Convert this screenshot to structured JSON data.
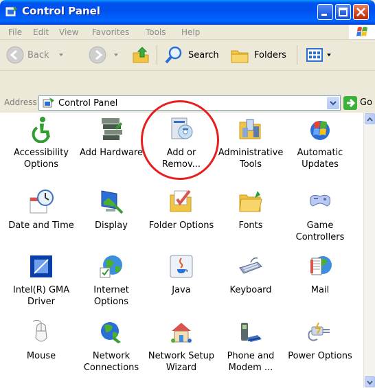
{
  "window": {
    "title": "Control Panel"
  },
  "menu": {
    "items": [
      "File",
      "Edit",
      "View",
      "Favorites",
      "Tools",
      "Help"
    ]
  },
  "toolbar": {
    "back": "Back",
    "search": "Search",
    "folders": "Folders"
  },
  "address": {
    "label": "Address",
    "value": "Control Panel",
    "go": "Go"
  },
  "items": [
    {
      "label": "Accessibility\nOptions",
      "icon": "accessibility-icon"
    },
    {
      "label": "Add Hardware",
      "icon": "add-hardware-icon"
    },
    {
      "label": "Add or\nRemov...",
      "icon": "add-remove-programs-icon"
    },
    {
      "label": "Administrative\nTools",
      "icon": "administrative-tools-icon"
    },
    {
      "label": "Automatic\nUpdates",
      "icon": "automatic-updates-icon"
    },
    {
      "label": "Date and Time",
      "icon": "date-time-icon"
    },
    {
      "label": "Display",
      "icon": "display-icon"
    },
    {
      "label": "Folder Options",
      "icon": "folder-options-icon"
    },
    {
      "label": "Fonts",
      "icon": "fonts-folder-icon"
    },
    {
      "label": "Game\nControllers",
      "icon": "game-controller-icon"
    },
    {
      "label": "Intel(R) GMA\nDriver",
      "icon": "intel-gma-icon"
    },
    {
      "label": "Internet\nOptions",
      "icon": "internet-options-icon"
    },
    {
      "label": "Java",
      "icon": "java-icon"
    },
    {
      "label": "Keyboard",
      "icon": "keyboard-icon"
    },
    {
      "label": "Mail",
      "icon": "mail-icon"
    },
    {
      "label": "Mouse",
      "icon": "mouse-icon"
    },
    {
      "label": "Network\nConnections",
      "icon": "network-connections-icon"
    },
    {
      "label": "Network Setup\nWizard",
      "icon": "network-setup-wizard-icon"
    },
    {
      "label": "Phone and\nModem ...",
      "icon": "phone-modem-icon"
    },
    {
      "label": "Power Options",
      "icon": "power-options-icon"
    }
  ],
  "colors": {
    "titlebar": "#0053ee",
    "highlight": "#e61e1e"
  }
}
